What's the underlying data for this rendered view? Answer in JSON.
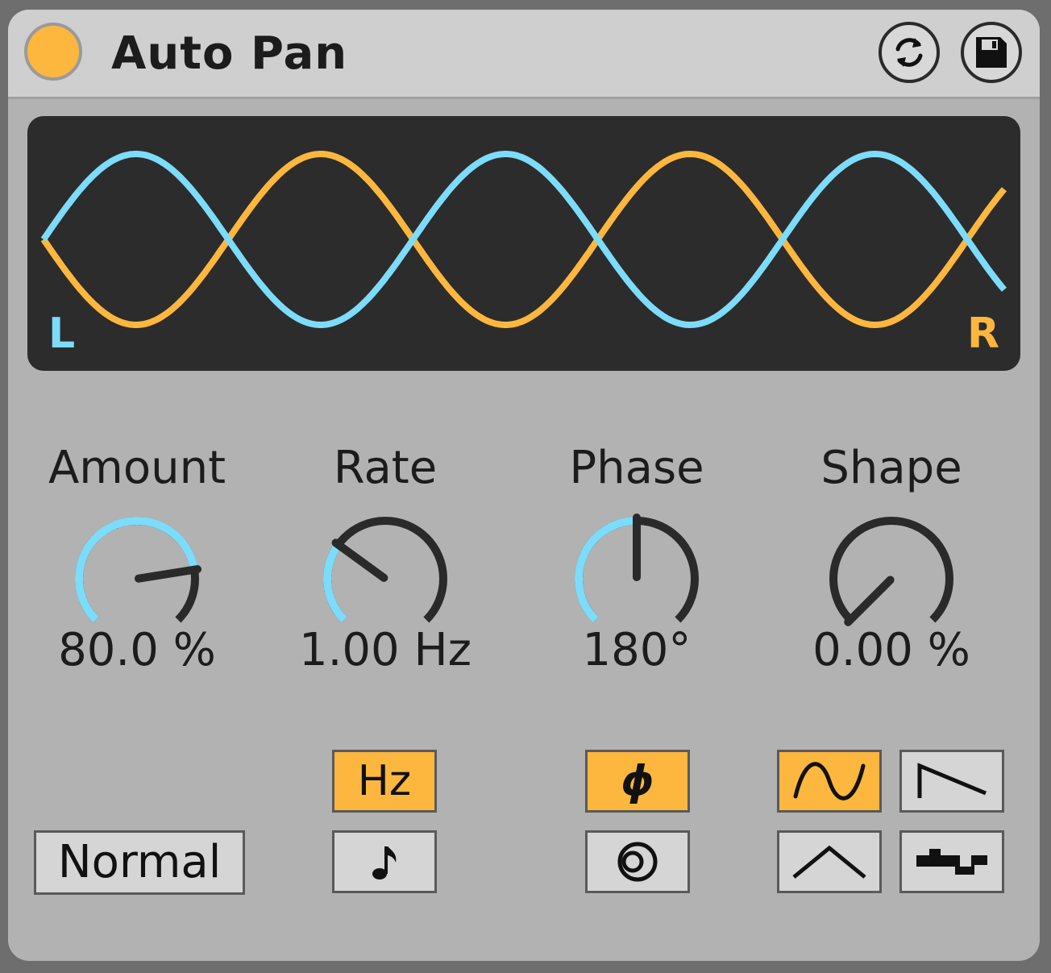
{
  "device": {
    "title": "Auto Pan",
    "power_icon": "power-indicator",
    "hotswap_icon": "hot-swap-icon",
    "save_icon": "save-preset-icon"
  },
  "display": {
    "left_label": "L",
    "right_label": "R",
    "left_color": "#7cdcfa",
    "right_color": "#fdb73e",
    "cycles": 2.6
  },
  "knobs": {
    "amount": {
      "label": "Amount",
      "value": "80.0 %",
      "fraction": 0.8
    },
    "rate": {
      "label": "Rate",
      "value": "1.00 Hz",
      "fraction": 0.3
    },
    "phase": {
      "label": "Phase",
      "value": "180°",
      "fraction": 0.5
    },
    "shape": {
      "label": "Shape",
      "value": "0.00 %",
      "fraction": 0.0
    }
  },
  "buttons": {
    "mode": {
      "label": "Normal"
    },
    "rate_hz": {
      "label": "Hz",
      "active": true
    },
    "rate_sync": {
      "icon": "eighth-note-icon",
      "active": false
    },
    "phase_mode": {
      "label": "ϕ",
      "active": true
    },
    "spin_mode": {
      "icon": "spin-icon",
      "active": false
    },
    "wave_sine": {
      "icon": "sine-wave-icon",
      "active": true
    },
    "wave_saw": {
      "icon": "sawtooth-down-icon",
      "active": false
    },
    "wave_triangle": {
      "icon": "triangle-wave-icon",
      "active": false
    },
    "wave_random": {
      "icon": "random-step-icon",
      "active": false
    }
  },
  "colors": {
    "accent": "#fdb73e",
    "knob_fill": "#7cdcfa",
    "knob_track": "#2a2a2a"
  }
}
